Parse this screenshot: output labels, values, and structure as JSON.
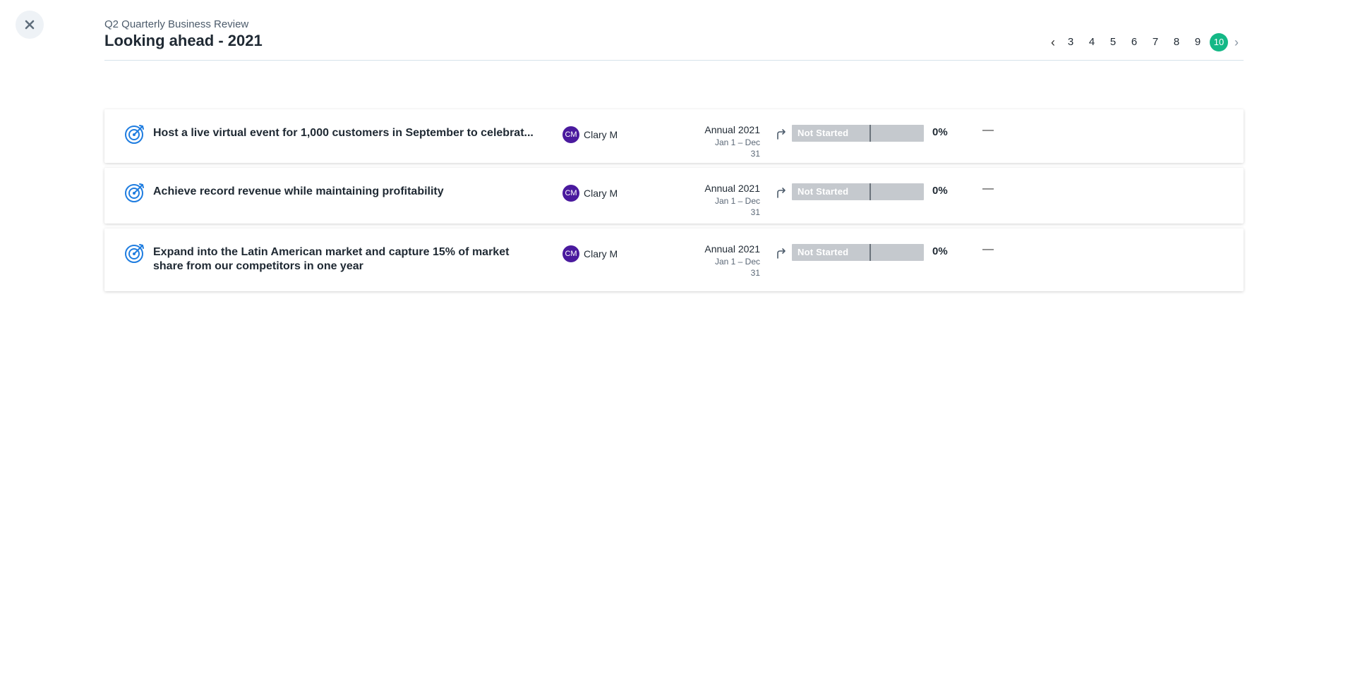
{
  "close": {
    "icon": "close-icon"
  },
  "header": {
    "subtitle": "Q2 Quarterly Business Review",
    "title": "Looking ahead - 2021"
  },
  "pager": {
    "prev": "‹",
    "next": "›",
    "pages": [
      "3",
      "4",
      "5",
      "6",
      "7",
      "8",
      "9",
      "10"
    ],
    "active": "10",
    "active_color": "#14b886"
  },
  "goals": [
    {
      "title": "Host a live virtual event for 1,000 customers in September to celebrat...",
      "owner_initials": "CM",
      "owner_name": "Clary M",
      "period": "Annual 2021",
      "range": "Jan 1 – Dec 31",
      "status": "Not Started",
      "progress": 0,
      "percent": "0%",
      "extra": "—"
    },
    {
      "title": "Achieve record revenue while maintaining profitability",
      "owner_initials": "CM",
      "owner_name": "Clary M",
      "period": "Annual 2021",
      "range": "Jan 1 – Dec 31",
      "status": "Not Started",
      "progress": 0,
      "percent": "0%",
      "extra": "—"
    },
    {
      "title": "Expand into the Latin American market and capture 15% of market share from our competitors in one year",
      "owner_initials": "CM",
      "owner_name": "Clary M",
      "period": "Annual 2021",
      "range": "Jan 1 – Dec 31",
      "status": "Not Started",
      "progress": 0,
      "percent": "0%",
      "extra": "—"
    }
  ],
  "colors": {
    "goal_icon": "#1f7de0",
    "avatar": "#4a1a9e",
    "progress_track": "#c5c9ce"
  }
}
